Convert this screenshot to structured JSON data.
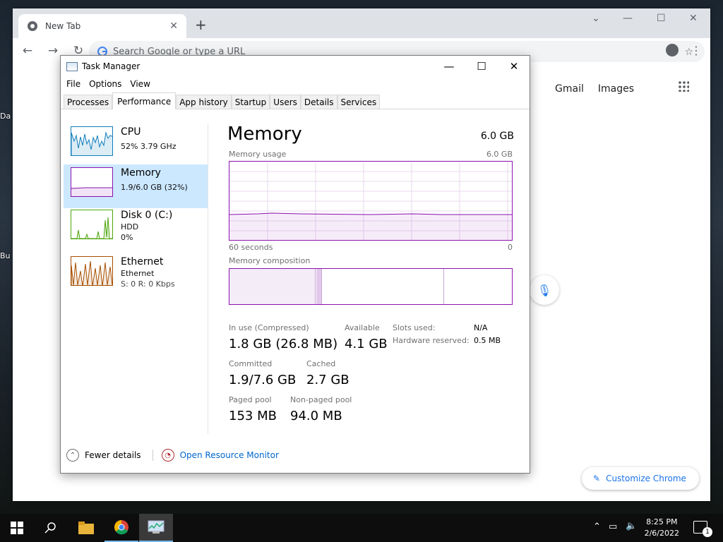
{
  "desktop": {
    "label1": "Da",
    "label2": "Bu"
  },
  "chrome": {
    "tab_title": "New Tab",
    "omnibox_placeholder": "Search Google or type a URL",
    "gmail": "Gmail",
    "images": "Images",
    "customize": "Customize Chrome"
  },
  "taskmanager": {
    "title": "Task Manager",
    "menu": [
      "File",
      "Options",
      "View"
    ],
    "tabs": [
      "Processes",
      "Performance",
      "App history",
      "Startup",
      "Users",
      "Details",
      "Services"
    ],
    "active_tab": "Performance",
    "resources": [
      {
        "name": "CPU",
        "sub1": "52%  3.79 GHz",
        "sub2": "",
        "color": "#117dbb"
      },
      {
        "name": "Memory",
        "sub1": "1.9/6.0 GB (32%)",
        "sub2": "",
        "color": "#8b12ae"
      },
      {
        "name": "Disk 0 (C:)",
        "sub1": "HDD",
        "sub2": "0%",
        "color": "#4da60c"
      },
      {
        "name": "Ethernet",
        "sub1": "Ethernet",
        "sub2": "S: 0 R: 0 Kbps",
        "color": "#a74f01"
      }
    ],
    "memory": {
      "heading": "Memory",
      "total": "6.0 GB",
      "usage_label": "Memory usage",
      "usage_max": "6.0 GB",
      "time_left": "60 seconds",
      "time_right": "0",
      "composition_label": "Memory composition",
      "in_use_label": "In use (Compressed)",
      "in_use_value": "1.8 GB (26.8 MB)",
      "available_label": "Available",
      "available_value": "4.1 GB",
      "slots_label": "Slots used:",
      "slots_value": "N/A",
      "hw_label": "Hardware reserved:",
      "hw_value": "0.5 MB",
      "committed_label": "Committed",
      "committed_value": "1.9/7.6 GB",
      "cached_label": "Cached",
      "cached_value": "2.7 GB",
      "paged_label": "Paged pool",
      "paged_value": "153 MB",
      "nonpaged_label": "Non-paged pool",
      "nonpaged_value": "94.0 MB",
      "usage_fraction": 0.32
    },
    "fewer_details": "Fewer details",
    "open_resource_monitor": "Open Resource Monitor"
  },
  "taskbar": {
    "time": "8:25 PM",
    "date": "2/6/2022",
    "notif_count": "1"
  }
}
